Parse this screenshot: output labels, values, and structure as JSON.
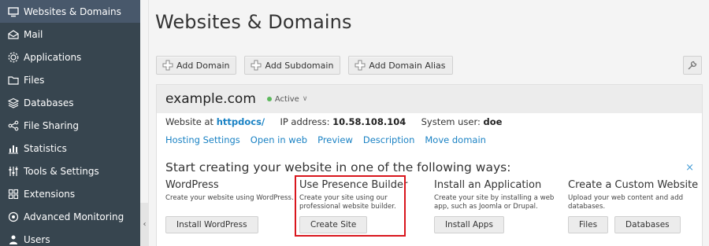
{
  "sidebar": {
    "items": [
      {
        "label": "Websites & Domains",
        "icon": "monitor-icon",
        "active": true
      },
      {
        "label": "Mail",
        "icon": "mail-icon"
      },
      {
        "label": "Applications",
        "icon": "applications-icon"
      },
      {
        "label": "Files",
        "icon": "folder-icon"
      },
      {
        "label": "Databases",
        "icon": "database-icon"
      },
      {
        "label": "File Sharing",
        "icon": "share-icon"
      },
      {
        "label": "Statistics",
        "icon": "statistics-icon"
      },
      {
        "label": "Tools & Settings",
        "icon": "tools-icon"
      },
      {
        "label": "Extensions",
        "icon": "extensions-icon"
      },
      {
        "label": "Advanced Monitoring",
        "icon": "monitoring-icon"
      },
      {
        "label": "Users",
        "icon": "users-icon"
      }
    ],
    "collapse_glyph": "‹"
  },
  "page": {
    "title": "Websites & Domains"
  },
  "toolbar": {
    "add_domain": "Add Domain",
    "add_subdomain": "Add Subdomain",
    "add_domain_alias": "Add Domain Alias"
  },
  "domain": {
    "name": "example.com",
    "status": "Active",
    "website_at_label": "Website at",
    "website_path": "httpdocs/",
    "ip_label": "IP address:",
    "ip_value": "10.58.108.104",
    "user_label": "System user:",
    "user_value": "doe",
    "links": [
      "Hosting Settings",
      "Open in web",
      "Preview",
      "Description",
      "Move domain"
    ]
  },
  "start": {
    "title": "Start creating your website in one of the following ways:",
    "close": "×",
    "options": [
      {
        "title": "WordPress",
        "desc": "Create your website using WordPress.",
        "buttons": [
          "Install WordPress"
        ]
      },
      {
        "title": "Use Presence Builder",
        "desc": "Create your site using our professional website builder.",
        "buttons": [
          "Create Site"
        ],
        "highlighted": true
      },
      {
        "title": "Install an Application",
        "desc": "Create your site by installing a web app, such as Joomla or Drupal.",
        "buttons": [
          "Install Apps"
        ]
      },
      {
        "title": "Create a Custom Website",
        "desc": "Upload your web content and add databases.",
        "buttons": [
          "Files",
          "Databases"
        ]
      }
    ]
  },
  "colors": {
    "sidebar_bg": "#37454f",
    "sidebar_active": "#48586b",
    "link": "#1a82c4",
    "status_green": "#5cb85c",
    "highlight_red": "#d9161d"
  }
}
